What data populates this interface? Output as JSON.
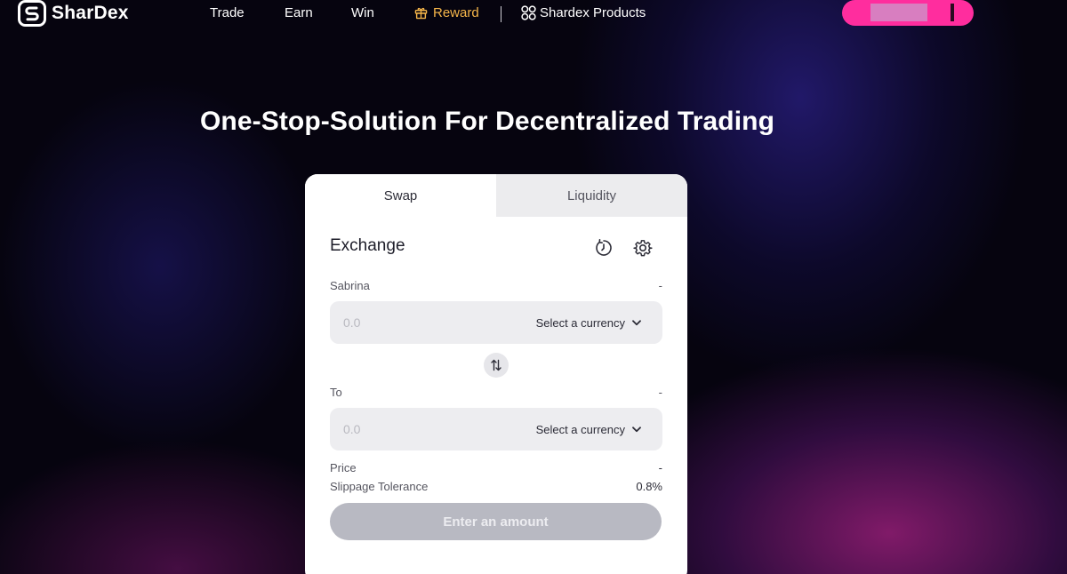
{
  "brand": {
    "name": "SharDex"
  },
  "nav": {
    "trade": "Trade",
    "earn": "Earn",
    "win": "Win",
    "reward": "Reward",
    "products": "Shardex Products"
  },
  "hero": {
    "title": "One-Stop-Solution For Decentralized Trading"
  },
  "card": {
    "tabs": [
      {
        "label": "Swap",
        "active": true
      },
      {
        "label": "Liquidity",
        "active": false
      }
    ],
    "title": "Exchange",
    "from": {
      "label": "Sabrina",
      "balance": "-",
      "placeholder": "0.0",
      "currency": "Select a currency"
    },
    "to": {
      "label": "To",
      "balance": "-",
      "placeholder": "0.0",
      "currency": "Select a currency"
    },
    "price": {
      "label": "Price",
      "value": "-"
    },
    "slippage": {
      "label": "Slippage Tolerance",
      "value": "0.8%"
    },
    "submit": "Enter an amount"
  },
  "colors": {
    "accent_pink": "#ff2d9e",
    "reward_gold": "#f6b64a",
    "disabled_button": "#b8b9c2"
  }
}
